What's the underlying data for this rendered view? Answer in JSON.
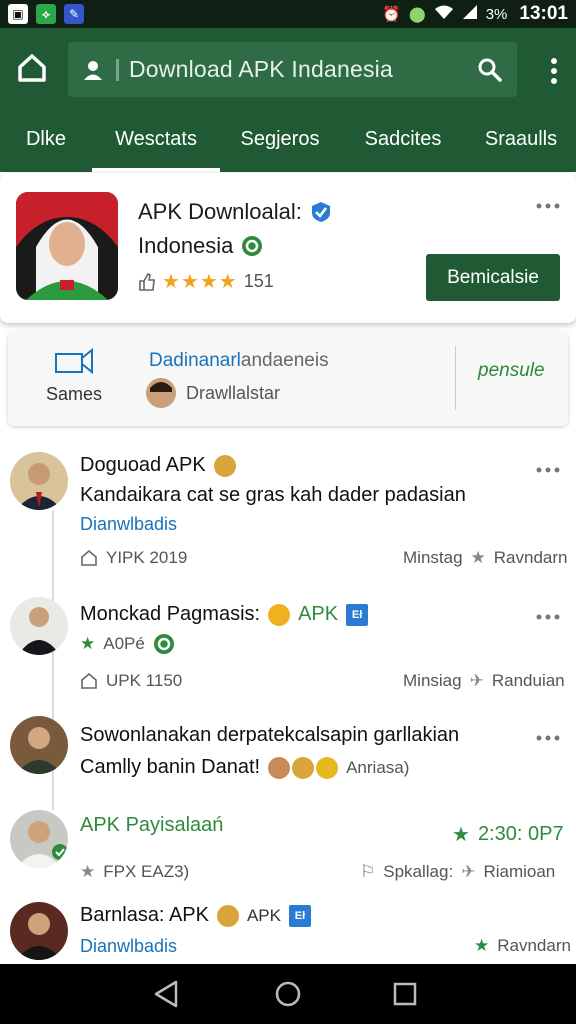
{
  "status_bar": {
    "time": "13:01",
    "battery": "3%"
  },
  "search": {
    "value": "Download APK Indanesia"
  },
  "tabs": [
    {
      "label": "Dlke"
    },
    {
      "label": "Wesctats"
    },
    {
      "label": "Segjeros"
    },
    {
      "label": "Sadcites"
    },
    {
      "label": "Sraaulls"
    }
  ],
  "app": {
    "title": "APK Downloalal:",
    "subtitle": "Indonesia",
    "rating_count": "151",
    "stars": "★★★★",
    "install_label": "Bemicalsie"
  },
  "info_strip": {
    "games_label": "Sames",
    "developer_highlight": "Dadinanarl",
    "developer_rest": "andaeneis",
    "developer_sub": "Drawllalstar",
    "brand": "pensule"
  },
  "posts": [
    {
      "title": "Doguoad APK",
      "body": "Kandaikara cat se gras kah dader padasian",
      "link": "Dianwlbadis",
      "meta_left": "YIPK 2019",
      "meta_mid": "Minstag",
      "meta_right": "Ravndarn"
    },
    {
      "title": "Monckad Pagmasis:",
      "title_tag": "APK",
      "badge": "Eł",
      "rating_tag": "A0Pé",
      "meta_left": "UPK 1150",
      "meta_mid": "Minsiag",
      "meta_right": "Randuian"
    },
    {
      "body_line1": "Sowonlanakan derpatekcalsapin garllakian",
      "body_line2": "Camlly banin Danat!",
      "tag": "Anriasa)"
    },
    {
      "title": "APK Payisalaań",
      "time": "2:30: 0P7",
      "meta_left": "FPX EAZ3)",
      "meta_mid": "Spkallag:",
      "meta_right": "Riamioan"
    },
    {
      "title": "Barnlasa: APK",
      "title_tag": "APK",
      "badge": "Eł",
      "link": "Dianwlbadis",
      "meta_right": "Ravndarn"
    }
  ],
  "colors": {
    "primary": "#1f5a34",
    "accent_green": "#2f8a3e",
    "link_blue": "#1a73b8",
    "star": "#f4a21b"
  }
}
